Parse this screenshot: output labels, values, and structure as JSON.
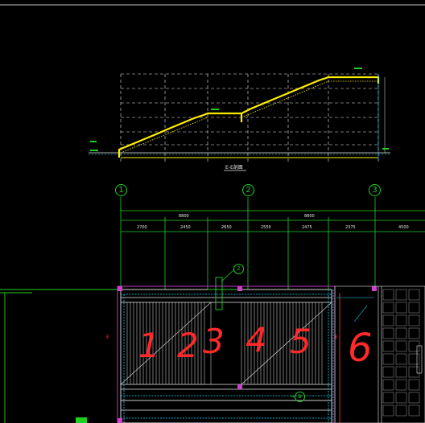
{
  "drawing": {
    "section_title": "E-E剖面",
    "axis_labels": [
      "1",
      "2",
      "3"
    ],
    "overall_dims": [
      "8800",
      "8800"
    ],
    "segment_dims": [
      "2700",
      "2450",
      "2650",
      "2550",
      "2475",
      "2375",
      "4500"
    ],
    "annotation_numbers": [
      "1",
      "2",
      "3",
      "4",
      "5",
      "6"
    ],
    "side_marks": [
      "E",
      "E"
    ],
    "bubble_labels": [
      "Z",
      "B"
    ]
  },
  "colors": {
    "background": "#000000",
    "grid": "#e8e8e8",
    "axis": "#1fd11f",
    "stair": "#ffee00",
    "annotation": "#ff2a2a",
    "cyan": "#18d8ff",
    "magenta": "#d040d0"
  }
}
